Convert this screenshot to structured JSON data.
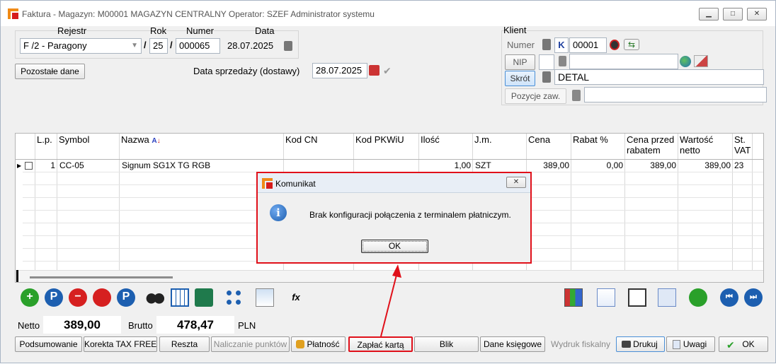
{
  "window": {
    "title": "Faktura - Magazyn: M00001 MAGAZYN CENTRALNY  Operator: SZEF Administrator systemu",
    "minimize_glyph": "▁",
    "maximize_glyph": "□",
    "close_glyph": "✕"
  },
  "header": {
    "rejestr_label": "Rejestr",
    "rok_label": "Rok",
    "numer_label": "Numer",
    "data_label": "Data",
    "rejestr_value": "F /2  - Paragony",
    "slash": "/",
    "rok_value": "25",
    "numer_value": "000065",
    "data_value": "28.07.2025",
    "pozostale_button": "Pozostałe dane",
    "data_sprzedazy_label": "Data sprzedaży (dostawy)",
    "data_sprzedazy_value": "28.07.2025"
  },
  "klient": {
    "title": "Klient",
    "numer_label": "Numer",
    "nip_label": "NIP",
    "skrot_label": "Skrót",
    "pozycje_label": "Pozycje zaw.",
    "k_badge": "K",
    "numer_value": "00001",
    "skrot_value": "DETAL",
    "nip_value": "",
    "pozycje_value": ""
  },
  "table": {
    "columns": [
      "L.p.",
      "Symbol",
      "Nazwa",
      "Kod  CN",
      "Kod  PKWiU",
      "Ilość",
      "J.m.",
      "Cena",
      "Rabat %",
      "Cena przed rabatem",
      "Wartość netto",
      "St. VAT"
    ],
    "rows": [
      {
        "lp": "1",
        "symbol": "CC-05",
        "nazwa": "Signum SG1X TG RGB",
        "kod_cn": "",
        "kod_pkwiu": "",
        "ilosc": "1,00",
        "jm": "SZT",
        "cena": "389,00",
        "rabat": "0,00",
        "cena_przed": "389,00",
        "wartosc": "389,00",
        "vat": "23"
      }
    ]
  },
  "dialog": {
    "title": "Komunikat",
    "message": "Brak konfiguracji połączenia z terminalem płatniczym.",
    "ok_button": "OK",
    "close_glyph": "✕",
    "info_glyph": "i"
  },
  "totals": {
    "netto_label": "Netto",
    "netto_value": "389,00",
    "brutto_label": "Brutto",
    "brutto_value": "478,47",
    "currency": "PLN"
  },
  "buttons": {
    "podsumowanie": "Podsumowanie",
    "korekta": "Korekta TAX FREE",
    "reszta": "Reszta",
    "naliczanie": "Naliczanie punktów",
    "platnosc": "Płatność",
    "zaplac": "Zapłać kartą",
    "blik": "Blik",
    "dane_ksiegowe": "Dane księgowe",
    "wydruk": "Wydruk fiskalny",
    "drukuj": "Drukuj",
    "uwagi": "Uwagi",
    "ok": "OK"
  },
  "toolbar": {
    "add": "+",
    "preview": "P",
    "delete": "−",
    "p_icon": "P",
    "fx": "fx"
  },
  "colors": {
    "highlight": "#e0101a",
    "accent_blue": "#1d5fb0",
    "green": "#2aa02a"
  }
}
